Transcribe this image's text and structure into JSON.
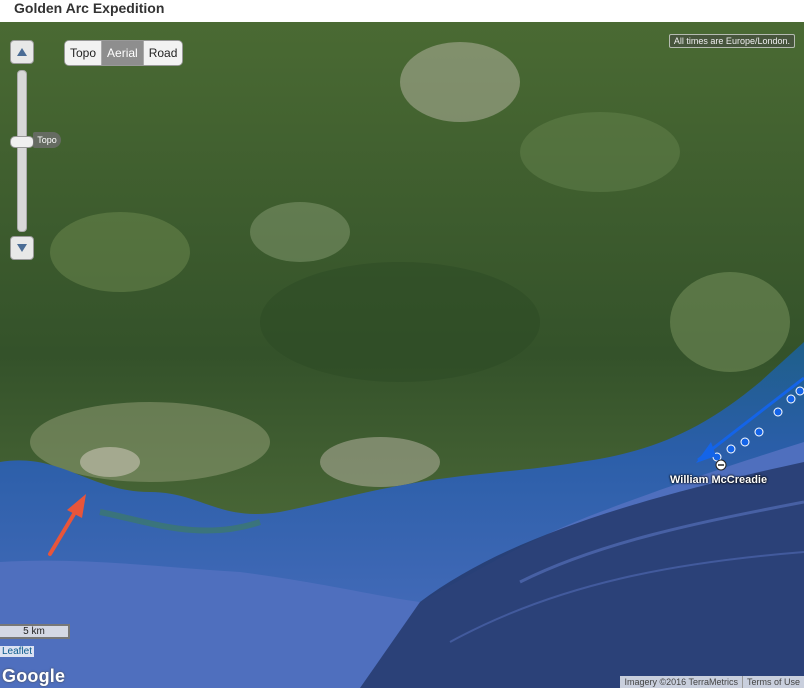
{
  "page": {
    "title": "Golden Arc Expedition"
  },
  "map": {
    "layers": [
      "Topo",
      "Aerial",
      "Road"
    ],
    "active_layer": "Aerial",
    "zoom_tooltip": "Topo",
    "timezone_note": "All times are Europe/London.",
    "scale_label": "5 km",
    "leaflet_label": "Leaflet",
    "provider_logo": "Google",
    "imagery_credit": "Imagery ©2016 TerraMetrics",
    "terms_label": "Terms of Use",
    "track_color": "#1464e8",
    "marker": {
      "name": "William McCreadie"
    },
    "annotation_color": "#e8553a"
  },
  "icons": {
    "zoom_in": "triangle-up-icon",
    "zoom_out": "triangle-down-icon",
    "position": "arrow-marker-icon",
    "waypoint": "dot-icon"
  }
}
